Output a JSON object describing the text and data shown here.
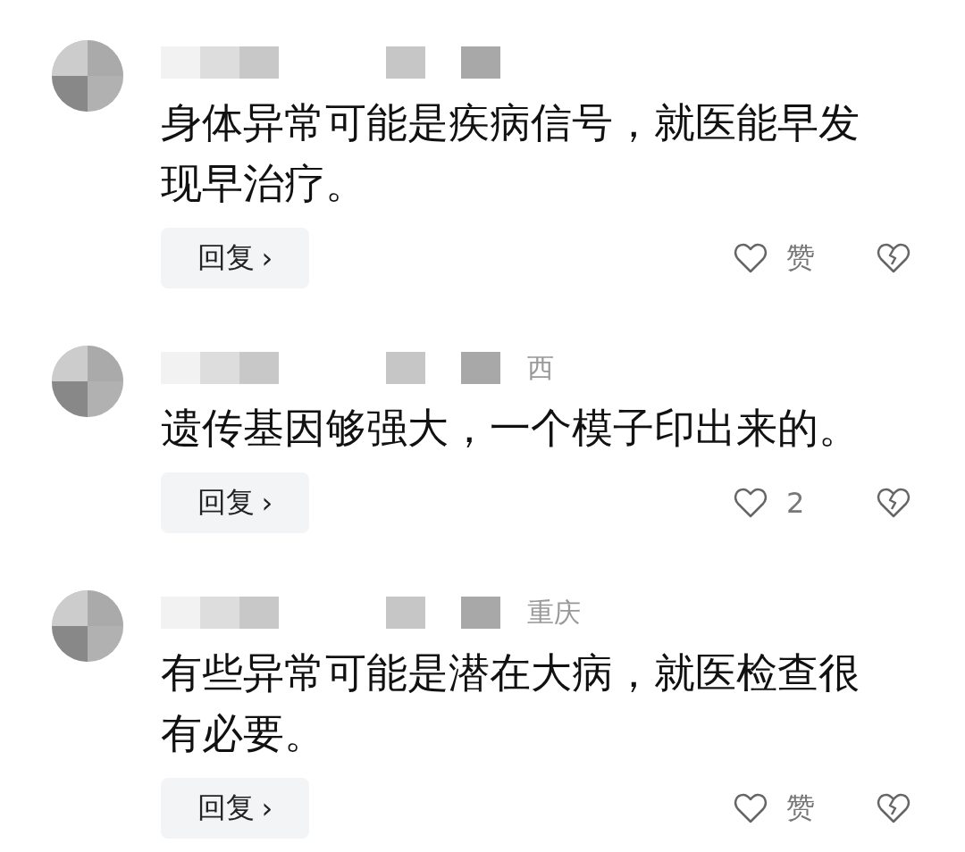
{
  "comments": [
    {
      "text": "身体异常可能是疾病信号，就医能早发现早治疗。",
      "reply_label": "回复",
      "reply_chevron": "›",
      "like_label": "赞"
    },
    {
      "location": "西",
      "text": "遗传基因够强大，一个模子印出来的。",
      "reply_label": "回复",
      "reply_chevron": "›",
      "like_label": "2"
    },
    {
      "location": "重庆",
      "text": "有些异常可能是潜在大病，就医检查很有必要。",
      "reply_label": "回复",
      "reply_chevron": "›",
      "like_label": "赞"
    }
  ]
}
